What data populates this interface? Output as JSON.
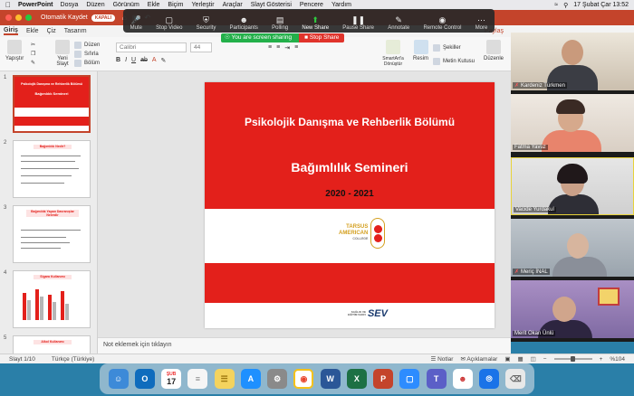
{
  "menubar": {
    "app": "PowerPoint",
    "items": [
      "Dosya",
      "Düzen",
      "Görünüm",
      "Ekle",
      "Biçim",
      "Yerleştir",
      "Araçlar",
      "Slayt Gösterisi",
      "Pencere",
      "Yardım"
    ],
    "date_time": "17 Şubat Çar  13:52"
  },
  "titlebar": {
    "autosave_label": "Otomatik Kaydet",
    "autosave_state": "KAPALI"
  },
  "zoom_toolbar": {
    "mute": "Mute",
    "stop_video": "Stop Video",
    "security": "Security",
    "participants": "Participants",
    "polling": "Polling",
    "new_share": "New Share",
    "pause_share": "Pause Share",
    "annotate": "Annotate",
    "remote_control": "Remote Control",
    "more": "More",
    "screen_sharing": "You are screen sharing",
    "stop_share": "Stop Share"
  },
  "ribbon": {
    "tabs": [
      "Giriş",
      "Ekle",
      "Çiz",
      "Tasarım"
    ],
    "share_label": "Paylaş",
    "paste": "Yapıştır",
    "new_slide": "Yeni Slayt",
    "layout": "Düzen",
    "reset": "Sıfırla",
    "section": "Bölüm",
    "font_name": "Calibri",
    "font_size": "44",
    "smartart": "SmartArt'a Dönüştür",
    "picture": "Resim",
    "shapes": "Şekiller",
    "textbox": "Metin Kutusu",
    "arrange": "Düzenle"
  },
  "thumbnails": [
    {
      "num": "1",
      "title": "Bağımlılık Semineri",
      "dept": "Psikolojik Danışma ve Rehberlik Bölümü"
    },
    {
      "num": "2",
      "title": "Bağımlılık Nedir?"
    },
    {
      "num": "3",
      "title": "Bağımlılık Yapan Davranışlar Nelerdir"
    },
    {
      "num": "4",
      "title": "Sigara Kullanımı"
    },
    {
      "num": "5",
      "title": "Alkol Kullanımı"
    }
  ],
  "slide": {
    "department": "Psikolojik Danışma ve Rehberlik Bölümü",
    "title": "Bağımlılık Semineri",
    "year": "2020 - 2021",
    "logo_line1": "TARSUS",
    "logo_line2": "AMERICAN",
    "logo_line3": "COLLEGE",
    "sev_small1": "SAĞLIK VE",
    "sev_small2": "EĞİTİM VAKFI",
    "sev_logo": "SEV"
  },
  "notes_placeholder": "Not eklemek için tıklayın",
  "statusbar": {
    "slide_counter": "Slayt 1/10",
    "language": "Türkçe (Türkiye)",
    "notes": "Notlar",
    "comments": "Açıklamalar",
    "zoom": "%104"
  },
  "participants": [
    {
      "name": "Kardeniz Türkmen",
      "muted": true
    },
    {
      "name": "Fatma Yavuz",
      "muted": false
    },
    {
      "name": "Vacide Yurdakul",
      "muted": false
    },
    {
      "name": "Meriç İNAL",
      "muted": true
    },
    {
      "name": "Merit Okan Ünlü",
      "muted": false
    }
  ],
  "dock": {
    "calendar_month": "ŞUB",
    "calendar_day": "17"
  },
  "colors": {
    "ppt_red": "#c4442b",
    "slide_red": "#e3201b",
    "share_green": "#23b04a",
    "stop_red": "#e0332b"
  }
}
